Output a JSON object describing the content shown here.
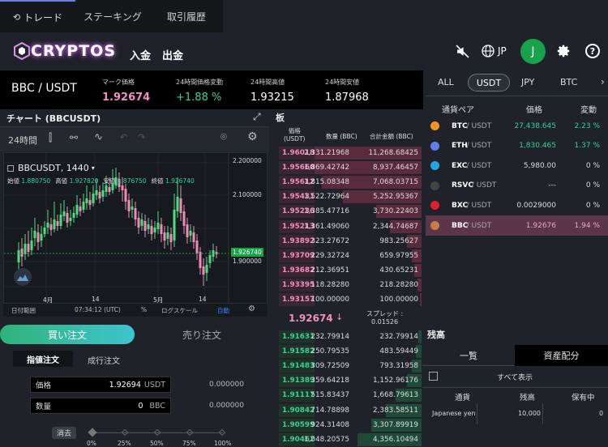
{
  "top_tabs": [
    {
      "label": "トレード"
    },
    {
      "label": "ステーキング"
    },
    {
      "label": "取引履歴"
    }
  ],
  "header": {
    "logo": "CRYPTOS",
    "deposit": "入金",
    "withdraw": "出金",
    "lang": "JP",
    "avatar": "J"
  },
  "ticker": {
    "pair": "BBC / USDT",
    "items": [
      {
        "label": "マーク価格",
        "value": "1.92674",
        "color": "#f28fc0"
      },
      {
        "label": "24時間価格変動",
        "value": "+1.88 %",
        "color": "#34d399"
      },
      {
        "label": "24時間高値",
        "value": "1.93215",
        "color": "#ffffff"
      },
      {
        "label": "24時間安値",
        "value": "1.87968",
        "color": "#ffffff"
      }
    ]
  },
  "chart": {
    "title": "チャート (BBCUSDT)",
    "interval": "24時間",
    "symbol": "BBCUSDT, 1440",
    "ohlc": [
      {
        "k": "始値",
        "v": "1.880750"
      },
      {
        "k": "高値",
        "v": "1.927820"
      },
      {
        "k": "安値",
        "v": "1.876750"
      },
      {
        "k": "終値",
        "v": "1.926740"
      }
    ],
    "yticks": [
      "2.200000",
      "2.100000",
      "1.900000"
    ],
    "current_price": "1.926740",
    "xticks": [
      "4月",
      "14",
      "5月",
      "14"
    ],
    "footer": {
      "range": "日付範囲",
      "time": "07:34:12 (UTC)",
      "pct": "%",
      "log": "ログスケール",
      "auto": "自動"
    }
  },
  "order_panel": {
    "buy_tab": "買い注文",
    "sell_tab": "売り注文",
    "limit": "指値注文",
    "market": "成行注文",
    "price_label": "価格",
    "price_value": "1.92694",
    "price_unit": "USDT",
    "price_total": "0.000000",
    "qty_label": "数量",
    "qty_value": "0",
    "qty_unit": "BBC",
    "qty_total": "0.000000",
    "clear": "消去",
    "slider": [
      "0%",
      "25%",
      "50%",
      "75%",
      "100%"
    ]
  },
  "order_book": {
    "title": "板",
    "cols": {
      "price": "価格\n(USDT)",
      "qty": "数量 (BBC)",
      "total": "合計金額 (BBC)"
    },
    "asks": [
      {
        "p": "1.96018",
        "q": "2,331.21968",
        "t": "11,268.68425",
        "d": 0.95
      },
      {
        "p": "1.95660",
        "q": "1,869.42742",
        "t": "8,937.46457",
        "d": 0.8
      },
      {
        "p": "1.95612",
        "q": "1,815.08348",
        "t": "7,068.03715",
        "d": 0.7
      },
      {
        "p": "1.95431",
        "q": "1,522.72964",
        "t": "5,252.95367",
        "d": 0.55
      },
      {
        "p": "1.95236",
        "q": "1,385.47716",
        "t": "3,730.22403",
        "d": 0.32
      },
      {
        "p": "1.95213",
        "q": "1,361.49060",
        "t": "2,344.74687",
        "d": 0.22
      },
      {
        "p": "1.93892",
        "q": "323.27672",
        "t": "983.25627",
        "d": 0.1
      },
      {
        "p": "1.93709",
        "q": "229.32724",
        "t": "659.97955",
        "d": 0.07
      },
      {
        "p": "1.93682",
        "q": "212.36951",
        "t": "430.65231",
        "d": 0.05
      },
      {
        "p": "1.93395",
        "q": "118.28280",
        "t": "218.28280",
        "d": 0.03
      },
      {
        "p": "1.93157",
        "q": "100.00000",
        "t": "100.00000",
        "d": 0.01
      }
    ],
    "mid": {
      "price": "1.92674",
      "spread_label": "スプレッド :",
      "spread": "0.01526"
    },
    "bids": [
      {
        "p": "1.91631",
        "q": "232.79914",
        "t": "232.79914",
        "d": 0.02
      },
      {
        "p": "1.91582",
        "q": "250.79535",
        "t": "483.59449",
        "d": 0.04
      },
      {
        "p": "1.91483",
        "q": "309.72509",
        "t": "793.31958",
        "d": 0.07
      },
      {
        "p": "1.91389",
        "q": "359.64218",
        "t": "1,152.96176",
        "d": 0.1
      },
      {
        "p": "1.91117",
        "q": "515.83437",
        "t": "1,668.79613",
        "d": 0.18
      },
      {
        "p": "1.90842",
        "q": "714.78898",
        "t": "2,383.58511",
        "d": 0.25
      },
      {
        "p": "1.90599",
        "q": "924.31408",
        "t": "3,307.89919",
        "d": 0.35
      },
      {
        "p": "1.90462",
        "q": "1,048.20575",
        "t": "4,356.10494",
        "d": 0.45
      }
    ]
  },
  "market": {
    "tabs": [
      "ALL",
      "USDT",
      "JPY",
      "BTC"
    ],
    "cols": {
      "pair": "通貨ペア",
      "price": "価格",
      "change": "変動"
    },
    "rows": [
      {
        "sym": "BTC",
        "quote": " / USDT",
        "price": "27,438.645",
        "change": "2.23 %",
        "pc": "#34d399",
        "cc": "#34d399",
        "icon": "#f7931a"
      },
      {
        "sym": "ETH",
        "quote": " / USDT",
        "price": "1,830.465",
        "change": "1.37 %",
        "pc": "#34d399",
        "cc": "#34d399",
        "icon": "#627eea"
      },
      {
        "sym": "EXC",
        "quote": " / USDT",
        "price": "5,980.00",
        "change": "0 %",
        "pc": "#dddddd",
        "cc": "#dddddd",
        "icon": "#1ea7e4"
      },
      {
        "sym": "RSVC",
        "quote": " / USDT",
        "price": "---",
        "change": "0 %",
        "pc": "#dddddd",
        "cc": "#dddddd",
        "icon": "#444"
      },
      {
        "sym": "BXC",
        "quote": " / USDT",
        "price": "0.0029000",
        "change": "0 %",
        "pc": "#dddddd",
        "cc": "#dddddd",
        "icon": "#e11d2f"
      },
      {
        "sym": "BBC",
        "quote": " / USDT",
        "price": "1.92676",
        "change": "1.94 %",
        "pc": "#f5a3c7",
        "cc": "#f5a3c7",
        "icon": "#c97b4a"
      }
    ]
  },
  "balance": {
    "title": "残高",
    "tab_list": "一覧",
    "tab_alloc": "資産配分",
    "show_all": "すべて表示",
    "cols": {
      "currency": "通貨",
      "balance": "残高",
      "hold": "保有中"
    },
    "rows": [
      {
        "currency": "Japanese yen",
        "balance": "10,000",
        "hold": "0"
      }
    ]
  }
}
